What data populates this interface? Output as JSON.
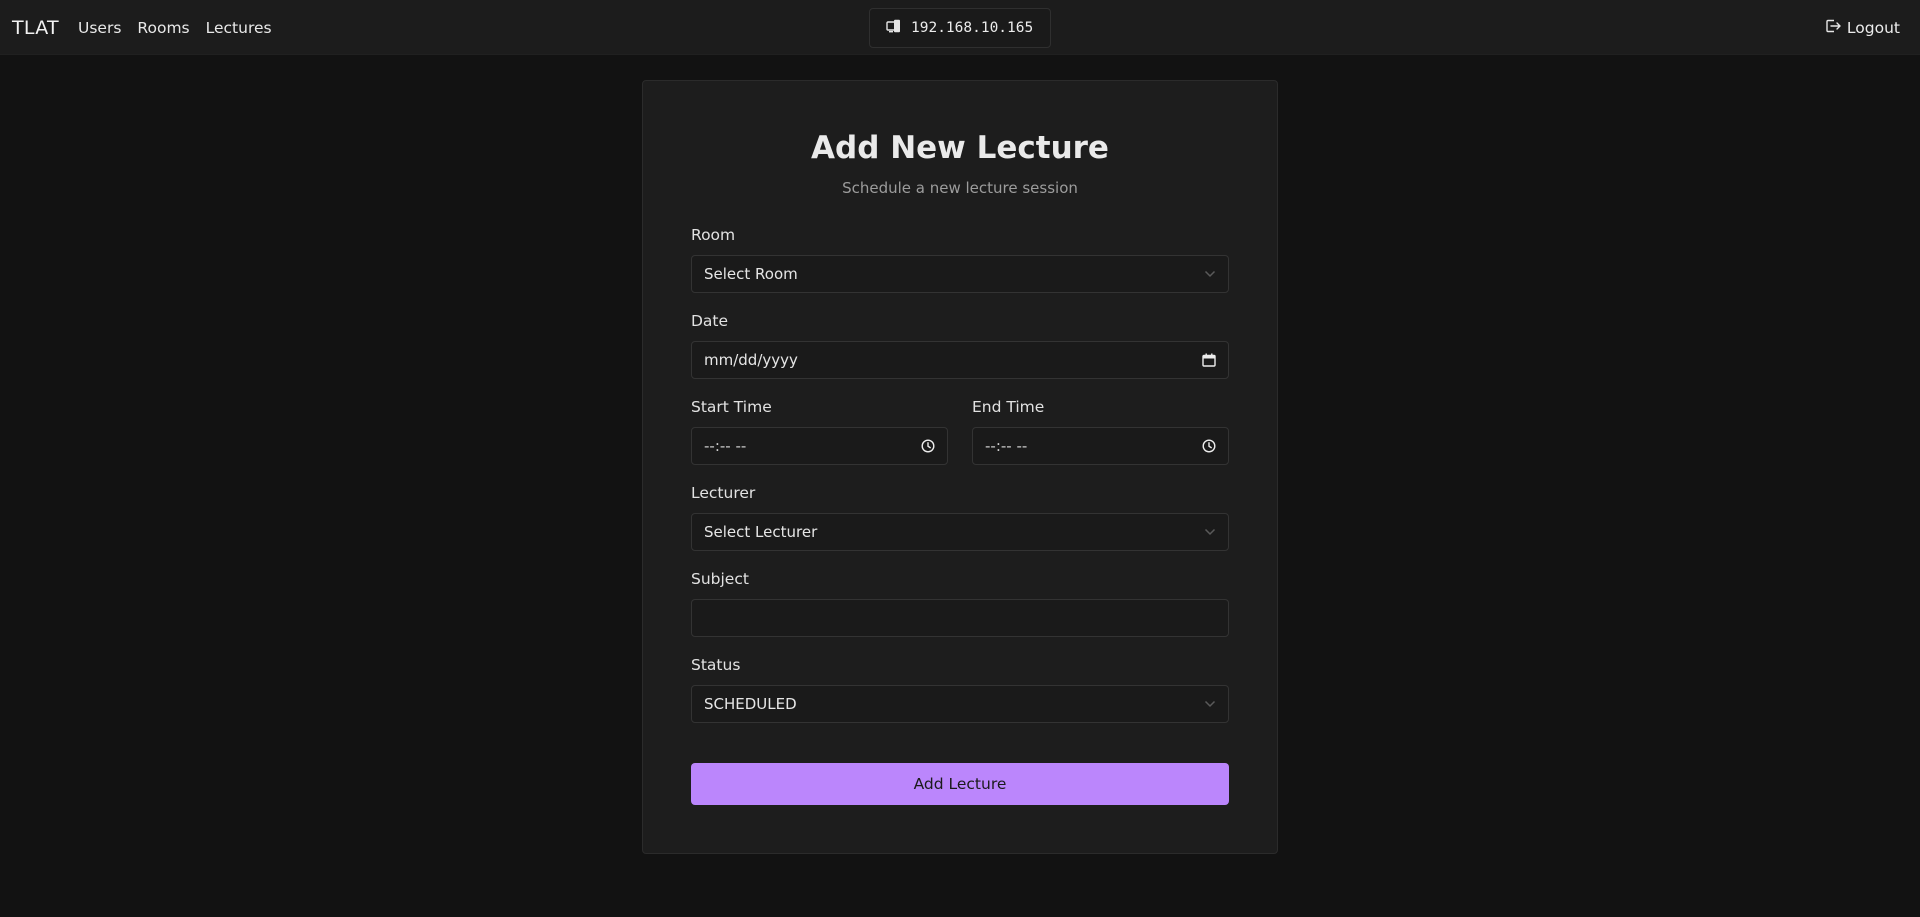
{
  "navbar": {
    "brand": "TLAT",
    "links": [
      "Users",
      "Rooms",
      "Lectures"
    ],
    "ip_address": "192.168.10.165",
    "ip_icon": "devices-icon",
    "logout_label": "Logout",
    "logout_icon": "logout-icon"
  },
  "form": {
    "title": "Add New Lecture",
    "subtitle": "Schedule a new lecture session",
    "room": {
      "label": "Room",
      "value": "Select Room"
    },
    "date": {
      "label": "Date",
      "value": "mm/dd/yyyy"
    },
    "start_time": {
      "label": "Start Time",
      "value": "--:-- --"
    },
    "end_time": {
      "label": "End Time",
      "value": "--:-- --"
    },
    "lecturer": {
      "label": "Lecturer",
      "value": "Select Lecturer"
    },
    "subject": {
      "label": "Subject",
      "value": ""
    },
    "status": {
      "label": "Status",
      "value": "SCHEDULED"
    },
    "submit_label": "Add Lecture"
  },
  "colors": {
    "page_background": "#121212",
    "navbar_background": "#1c1c1c",
    "card_background": "#1d1d1d",
    "accent": "#bb86fc"
  }
}
